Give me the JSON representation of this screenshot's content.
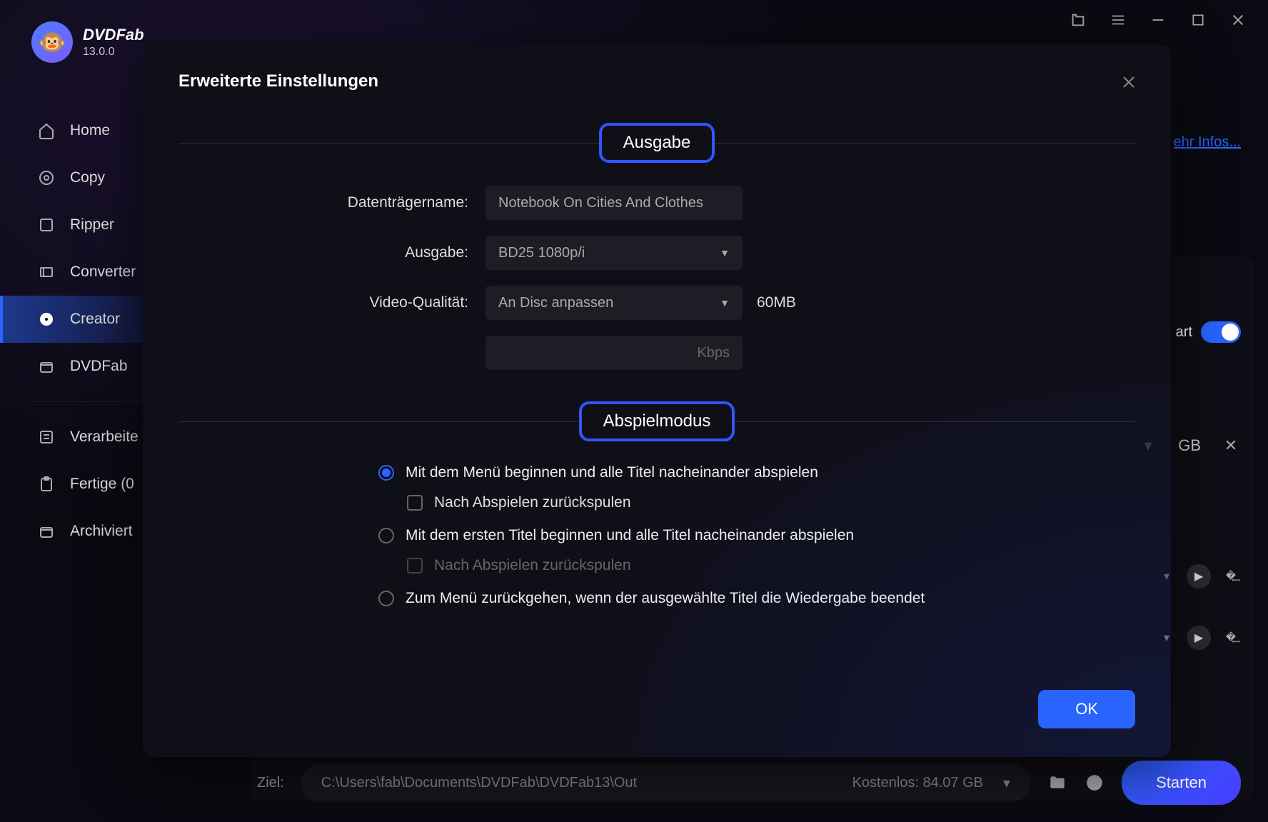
{
  "brand": {
    "name": "DVDFab",
    "version": "13.0.0"
  },
  "sidebar": {
    "items": [
      {
        "label": "Home"
      },
      {
        "label": "Copy"
      },
      {
        "label": "Ripper"
      },
      {
        "label": "Converter"
      },
      {
        "label": "Creator"
      },
      {
        "label": "DVDFab"
      }
    ],
    "lower": [
      {
        "label": "Verarbeite"
      },
      {
        "label": "Fertige (0"
      },
      {
        "label": "Archiviert"
      }
    ]
  },
  "link_more": "ehr Infos...",
  "smart_label": "art",
  "gb_label": "GB",
  "bottom": {
    "dest_label": "Ziel:",
    "dest_path": "C:\\Users\\fab\\Documents\\DVDFab\\DVDFab13\\Out",
    "free_label": "Kostenlos: 84.07 GB",
    "start": "Starten"
  },
  "dialog": {
    "title": "Erweiterte Einstellungen",
    "section_output": "Ausgabe",
    "fields": {
      "volume_label": "Datenträgername:",
      "volume_value": "Notebook On Cities And Clothes",
      "output_label": "Ausgabe:",
      "output_value": "BD25 1080p/i",
      "quality_label": "Video-Qualität:",
      "quality_value": "An Disc anpassen",
      "quality_suffix": "60MB",
      "bitrate_unit": "Kbps"
    },
    "section_play": "Abspielmodus",
    "play_options": {
      "opt1": "Mit dem Menü beginnen und alle Titel nacheinander abspielen",
      "opt1_sub": "Nach Abspielen zurückspulen",
      "opt2": "Mit dem ersten Titel beginnen und alle Titel nacheinander abspielen",
      "opt2_sub": "Nach Abspielen zurückspulen",
      "opt3": "Zum Menü zurückgehen, wenn der ausgewählte Titel die Wiedergabe beendet"
    },
    "ok": "OK"
  }
}
